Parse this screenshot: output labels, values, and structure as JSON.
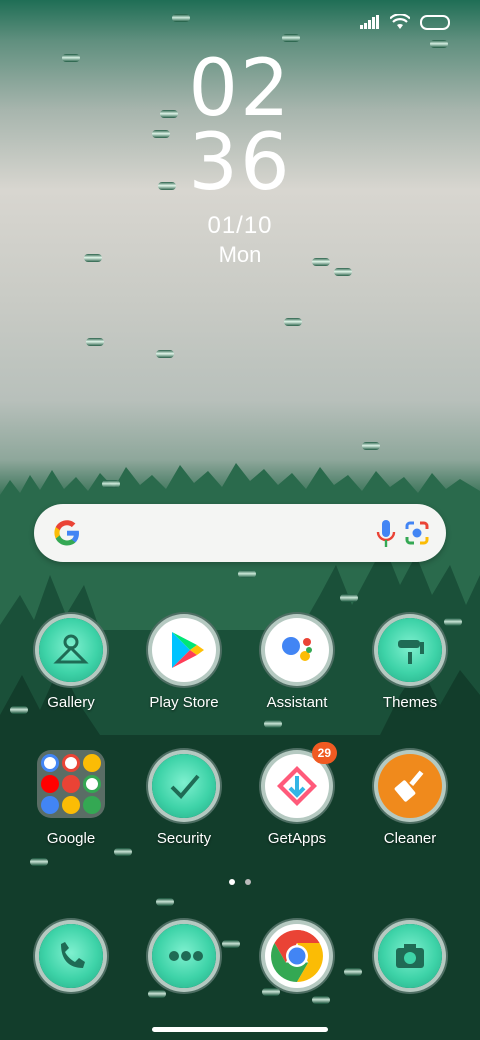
{
  "status_bar": {
    "signal_icon": "cell-signal-icon",
    "wifi_icon": "wifi-icon",
    "battery_icon": "battery-icon"
  },
  "clock": {
    "hour": "02",
    "minute": "36",
    "date": "01/10",
    "day": "Mon"
  },
  "search_bar": {
    "logo": "google-g-icon",
    "mic_icon": "microphone-icon",
    "lens_icon": "google-lens-icon"
  },
  "apps_row1": [
    {
      "label": "Gallery",
      "icon": "gallery-icon"
    },
    {
      "label": "Play Store",
      "icon": "play-store-icon"
    },
    {
      "label": "Assistant",
      "icon": "assistant-icon"
    },
    {
      "label": "Themes",
      "icon": "themes-icon"
    }
  ],
  "apps_row2": [
    {
      "label": "Google",
      "icon": "google-folder-icon"
    },
    {
      "label": "Security",
      "icon": "security-icon"
    },
    {
      "label": "GetApps",
      "icon": "getapps-icon",
      "badge": "29"
    },
    {
      "label": "Cleaner",
      "icon": "cleaner-icon"
    }
  ],
  "dock": [
    {
      "icon": "phone-icon"
    },
    {
      "icon": "messages-icon"
    },
    {
      "icon": "chrome-icon"
    },
    {
      "icon": "camera-icon"
    }
  ],
  "page_indicator": {
    "pages": 2,
    "active": 1
  },
  "colors": {
    "accent": "#3ed3a8",
    "badge": "#f05a22"
  }
}
